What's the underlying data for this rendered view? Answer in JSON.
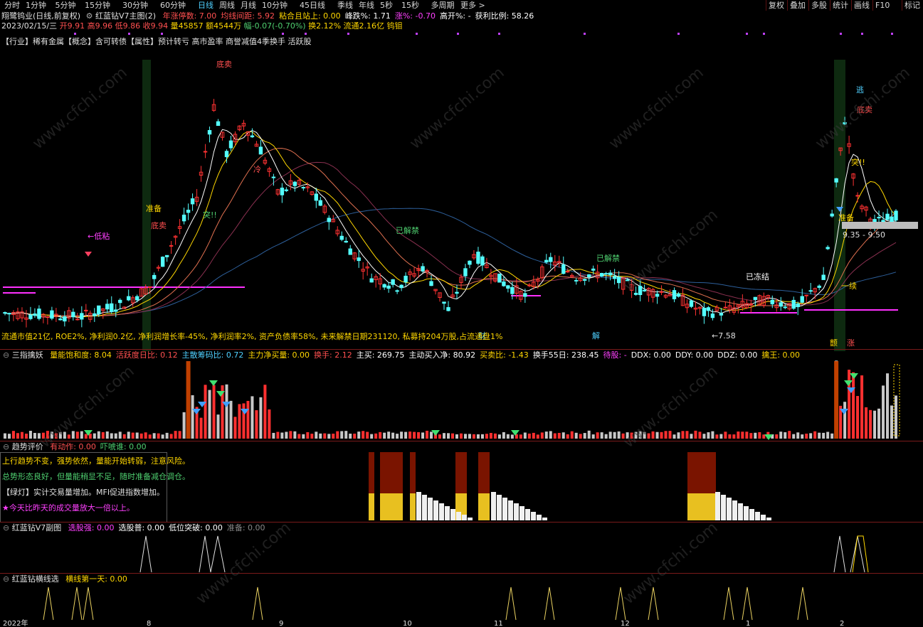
{
  "toolbar": {
    "periods": [
      "分时",
      "1分钟",
      "5分钟",
      "15分钟",
      "30分钟",
      "60分钟",
      "日线",
      "周线",
      "月线",
      "10分钟",
      "45日线",
      "季线",
      "年线",
      "5秒",
      "15秒",
      "多周期",
      "更多 >"
    ],
    "active": "日线",
    "right": [
      "复权",
      "叠加",
      "多股",
      "统计",
      "画线",
      "F10",
      "标记"
    ]
  },
  "main": {
    "title": "翔鹭钨业(日线,前复权)",
    "indicator": "红蓝钻V7主图(2)",
    "fields": [
      {
        "label": "年涨停数: 7.00",
        "color": "#ff5050"
      },
      {
        "label": "均线间距: 5.92",
        "color": "#ff5050"
      },
      {
        "label": "粘合且站上: 0.00",
        "color": "#ffd700"
      },
      {
        "label": "峰跌%: 1.71",
        "color": "#ffffff"
      },
      {
        "label": "涨%: -0.70",
        "color": "#ff40ff"
      },
      {
        "label": "高开%: -",
        "color": "#ffffff"
      },
      {
        "label": "获利比例: 58.26",
        "color": "#ffffff"
      }
    ],
    "quote": {
      "date": "2023/02/15/三",
      "open": "开9.91",
      "high": "高9.96",
      "low": "低9.86",
      "close": "收9.94",
      "vol": "量45857",
      "amt": "额4544万",
      "chg": "幅-0.07(-0.70%)",
      "turnover": "换2.12%",
      "float": "流通2.16亿",
      "concept": "钨钼"
    },
    "tags_line": "【行业】稀有金属【概念】含可转债【属性】预计转亏 高市盈率 商誉减值4季换手 活跃股",
    "bottom_info": "流通市值21亿, ROE2%, 净利润0.2亿, 净利润增长率-45%, 净利润率2%, 资产负债率58%, 未来解禁日期231120, 私募持204万股,占流通盘1%",
    "labels": {
      "zhunbei1": "准备",
      "dimai1": "底卖",
      "dizhan": "←低粘",
      "tupo1": "突!!",
      "dimai2": "底卖",
      "leng": "冷",
      "jinjie1": "已解禁",
      "jinjie2": "已解禁",
      "dongjie": "已冻结",
      "low": "←7.58",
      "cai": "财",
      "jie": "解",
      "tao": "逃",
      "dimai3": "底卖",
      "tupo2": "突!!",
      "zhunbei2": "准备",
      "range": "9.35 - 9.50",
      "xu": "一续",
      "ding": "颤",
      "zhang": "涨"
    }
  },
  "panel1": {
    "title": "三指擒妖",
    "fields": [
      {
        "label": "量能饱和度: 8.04",
        "color": "#ffd700"
      },
      {
        "label": "活跃度日比: 0.12",
        "color": "#ff5050"
      },
      {
        "label": "主散筹码比: 0.72",
        "color": "#4fd0ff"
      },
      {
        "label": "主力净买量: 0.00",
        "color": "#ffd700"
      },
      {
        "label": "换手: 2.12",
        "color": "#ff5050"
      },
      {
        "label": "主买: 269.75",
        "color": "#ffffff"
      },
      {
        "label": "主动买入净: 80.92",
        "color": "#ffffff"
      },
      {
        "label": "买卖比: -1.43",
        "color": "#ffd700"
      },
      {
        "label": "换手55日: 238.45",
        "color": "#ffffff"
      },
      {
        "label": "待股: -",
        "color": "#ff40ff"
      },
      {
        "label": "DDX: 0.00",
        "color": "#ffffff"
      },
      {
        "label": "DDY: 0.00",
        "color": "#ffffff"
      },
      {
        "label": "DDZ: 0.00",
        "color": "#ffffff"
      },
      {
        "label": "擒王: 0.00",
        "color": "#ffd700"
      }
    ]
  },
  "panel2": {
    "title": "趋势评价",
    "fields": [
      {
        "label": "有动作: 0.00",
        "color": "#ff5050"
      },
      {
        "label": "吓唬谁: 0.00",
        "color": "#4fd070"
      }
    ],
    "texts": [
      {
        "text": "上行趋势不变，强势依然，量能开始转弱，注意风险。",
        "color": "#ffd700"
      },
      {
        "text": "总势形态良好，但量能稍显不足，随时准备减仓调仓。",
        "color": "#4fd070"
      },
      {
        "text": "【绿灯】实计交易量增加。MFI促进指数增加。",
        "color": "#e0e0e0"
      },
      {
        "text": "★今天比昨天的成交量放大一倍以上。",
        "color": "#ff40ff"
      }
    ]
  },
  "panel3": {
    "title": "红蓝钻V7副图",
    "fields": [
      {
        "label": "选股强: 0.00",
        "color": "#ff40ff"
      },
      {
        "label": "选股普: 0.00",
        "color": "#ffffff"
      },
      {
        "label": "低位突破: 0.00",
        "color": "#ffffff"
      },
      {
        "label": "准备: 0.00",
        "color": "#888888"
      }
    ]
  },
  "panel4": {
    "title": "红蓝钻横线选",
    "fields": [
      {
        "label": "横线第一天: 0.00",
        "color": "#ffd700"
      }
    ]
  },
  "xaxis": [
    "2022年",
    "8",
    "9",
    "10",
    "11",
    "12",
    "1",
    "2"
  ],
  "colors": {
    "up": "#ff3232",
    "down": "#54ffff",
    "ma5": "#ffffff",
    "ma10": "#ffd700",
    "ma20": "#ff60ff",
    "ma60": "#2a5a8a",
    "grid": "#7a1a1a"
  }
}
